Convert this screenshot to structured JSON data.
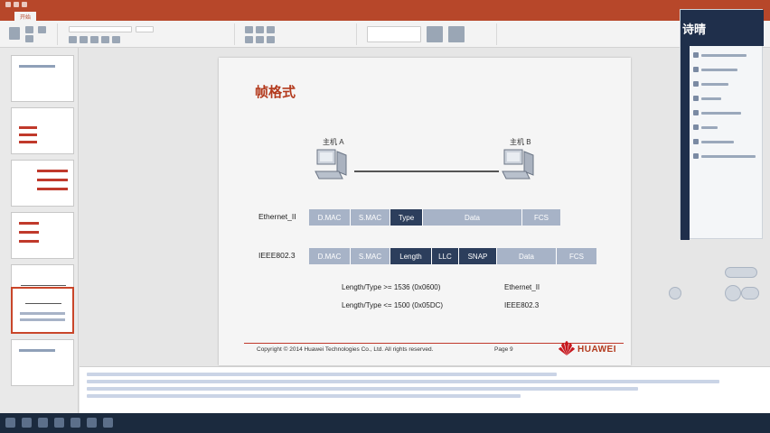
{
  "window": {
    "doc_title": "",
    "accent": "#b7472a"
  },
  "tabs": [
    {
      "label": ""
    },
    {
      "label": "开始"
    },
    {
      "label": ""
    },
    {
      "label": ""
    },
    {
      "label": ""
    },
    {
      "label": ""
    },
    {
      "label": ""
    },
    {
      "label": ""
    },
    {
      "label": ""
    }
  ],
  "slide": {
    "title": "帧格式",
    "host_a": "主机 A",
    "host_b": "主机 B",
    "ethernet_label": "Ethernet_II",
    "ethernet_fields": [
      "D.MAC",
      "S.MAC",
      "Type",
      "Data",
      "FCS"
    ],
    "ieee_label": "IEEE802.3",
    "ieee_fields": [
      "D.MAC",
      "S.MAC",
      "Length",
      "LLC",
      "SNAP",
      "Data",
      "FCS"
    ],
    "rule1_condition": "Length/Type >= 1536 (0x0600)",
    "rule1_result": "Ethernet_II",
    "rule2_condition": "Length/Type <= 1500 (0x05DC)",
    "rule2_result": "IEEE802.3",
    "copyright": "Copyright © 2014 Huawei Technologies Co., Ltd. All rights reserved.",
    "page": "Page 9",
    "logo_text": "HUAWEI",
    "colors": {
      "title": "#b33a1d",
      "field_light": "#a7b3c7",
      "field_dark": "#2c3e5c",
      "field_mid": "#7989a4"
    }
  },
  "chat": {
    "watermark": "诗晴"
  },
  "thumbnails": [
    {
      "num": ""
    },
    {
      "num": ""
    },
    {
      "num": ""
    },
    {
      "num": ""
    },
    {
      "num": ""
    },
    {
      "num": ""
    },
    {
      "num": ""
    }
  ]
}
